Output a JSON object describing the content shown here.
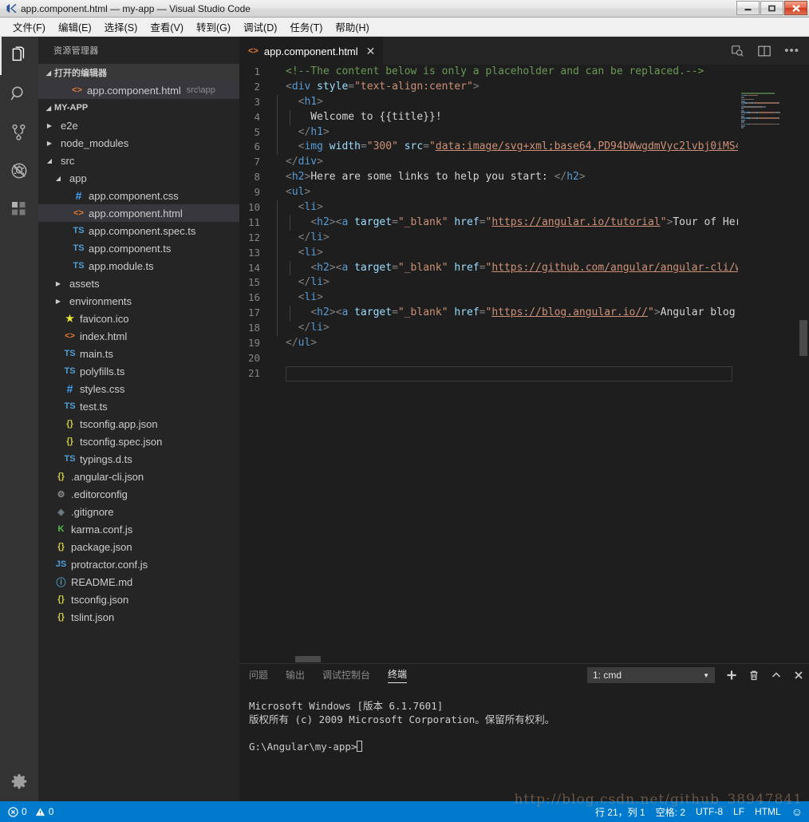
{
  "window": {
    "title": "app.component.html — my-app — Visual Studio Code",
    "logo_icon": "vscode-logo-icon",
    "minimize_label": "—",
    "maximize_label": "❐",
    "close_label": "✕"
  },
  "menubar": {
    "items": [
      {
        "label": "文件(F)",
        "name": "menu-file"
      },
      {
        "label": "编辑(E)",
        "name": "menu-edit"
      },
      {
        "label": "选择(S)",
        "name": "menu-selection"
      },
      {
        "label": "查看(V)",
        "name": "menu-view"
      },
      {
        "label": "转到(G)",
        "name": "menu-go"
      },
      {
        "label": "调试(D)",
        "name": "menu-debug"
      },
      {
        "label": "任务(T)",
        "name": "menu-tasks"
      },
      {
        "label": "帮助(H)",
        "name": "menu-help"
      }
    ]
  },
  "activitybar": {
    "items": [
      {
        "icon": "files-explorer-icon",
        "active": true
      },
      {
        "icon": "search-icon",
        "active": false
      },
      {
        "icon": "source-control-icon",
        "active": false
      },
      {
        "icon": "debug-icon",
        "active": false
      },
      {
        "icon": "extensions-icon",
        "active": false
      }
    ],
    "settings_icon": "gear-icon"
  },
  "sidebar": {
    "title": "资源管理器",
    "open_editors": {
      "header": "打开的编辑器",
      "items": [
        {
          "name": "app.component.html",
          "description": "src\\app",
          "icon": "html-file-icon"
        }
      ]
    },
    "root": {
      "header": "MY-APP",
      "tree": [
        {
          "label": "e2e",
          "type": "folder",
          "expanded": false,
          "indent": 1
        },
        {
          "label": "node_modules",
          "type": "folder",
          "expanded": false,
          "indent": 1
        },
        {
          "label": "src",
          "type": "folder",
          "expanded": true,
          "indent": 1
        },
        {
          "label": "app",
          "type": "folder",
          "expanded": true,
          "indent": 2
        },
        {
          "label": "app.component.css",
          "type": "css",
          "indent": 3
        },
        {
          "label": "app.component.html",
          "type": "html",
          "indent": 3,
          "selected": true
        },
        {
          "label": "app.component.spec.ts",
          "type": "ts",
          "indent": 3
        },
        {
          "label": "app.component.ts",
          "type": "ts",
          "indent": 3
        },
        {
          "label": "app.module.ts",
          "type": "ts",
          "indent": 3
        },
        {
          "label": "assets",
          "type": "folder",
          "expanded": false,
          "indent": 2
        },
        {
          "label": "environments",
          "type": "folder",
          "expanded": false,
          "indent": 2
        },
        {
          "label": "favicon.ico",
          "type": "star",
          "indent": 2
        },
        {
          "label": "index.html",
          "type": "html",
          "indent": 2
        },
        {
          "label": "main.ts",
          "type": "ts",
          "indent": 2
        },
        {
          "label": "polyfills.ts",
          "type": "ts",
          "indent": 2
        },
        {
          "label": "styles.css",
          "type": "css",
          "indent": 2
        },
        {
          "label": "test.ts",
          "type": "ts",
          "indent": 2
        },
        {
          "label": "tsconfig.app.json",
          "type": "json",
          "indent": 2
        },
        {
          "label": "tsconfig.spec.json",
          "type": "json",
          "indent": 2
        },
        {
          "label": "typings.d.ts",
          "type": "ts",
          "indent": 2
        },
        {
          "label": ".angular-cli.json",
          "type": "json",
          "indent": 1
        },
        {
          "label": ".editorconfig",
          "type": "gear",
          "indent": 1
        },
        {
          "label": ".gitignore",
          "type": "git",
          "indent": 1
        },
        {
          "label": "karma.conf.js",
          "type": "karma",
          "indent": 1
        },
        {
          "label": "package.json",
          "type": "json",
          "indent": 1
        },
        {
          "label": "protractor.conf.js",
          "type": "js",
          "indent": 1
        },
        {
          "label": "README.md",
          "type": "md",
          "indent": 1
        },
        {
          "label": "tsconfig.json",
          "type": "json",
          "indent": 1
        },
        {
          "label": "tslint.json",
          "type": "json",
          "indent": 1
        }
      ]
    }
  },
  "editor": {
    "tab": {
      "label": "app.component.html",
      "icon": "html-file-icon",
      "close_label": "✕"
    },
    "actions": [
      {
        "name": "split-editor-search-icon"
      },
      {
        "name": "split-editor-icon"
      },
      {
        "name": "more-actions-icon",
        "label": "•••"
      }
    ],
    "lines": [
      {
        "n": 1,
        "tokens": [
          {
            "t": "comment",
            "v": "<!--The content below is only a placeholder and can be replaced.-->"
          }
        ]
      },
      {
        "n": 2,
        "tokens": [
          {
            "t": "brk",
            "v": "<"
          },
          {
            "t": "tag",
            "v": "div"
          },
          {
            "t": "txt",
            "v": " "
          },
          {
            "t": "attr",
            "v": "style"
          },
          {
            "t": "brk",
            "v": "="
          },
          {
            "t": "str",
            "v": "\"text-align:center\""
          },
          {
            "t": "brk",
            "v": ">"
          }
        ]
      },
      {
        "n": 3,
        "indent": 1,
        "tokens": [
          {
            "t": "txt",
            "v": "  "
          },
          {
            "t": "brk",
            "v": "<"
          },
          {
            "t": "tag",
            "v": "h1"
          },
          {
            "t": "brk",
            "v": ">"
          }
        ]
      },
      {
        "n": 4,
        "indent": 2,
        "tokens": [
          {
            "t": "txt",
            "v": "    Welcome to {{title}}!"
          }
        ]
      },
      {
        "n": 5,
        "indent": 1,
        "tokens": [
          {
            "t": "txt",
            "v": "  "
          },
          {
            "t": "brk",
            "v": "</"
          },
          {
            "t": "tag",
            "v": "h1"
          },
          {
            "t": "brk",
            "v": ">"
          }
        ]
      },
      {
        "n": 6,
        "indent": 1,
        "tokens": [
          {
            "t": "txt",
            "v": "  "
          },
          {
            "t": "brk",
            "v": "<"
          },
          {
            "t": "tag",
            "v": "img"
          },
          {
            "t": "txt",
            "v": " "
          },
          {
            "t": "attr",
            "v": "width"
          },
          {
            "t": "brk",
            "v": "="
          },
          {
            "t": "str",
            "v": "\"300\""
          },
          {
            "t": "txt",
            "v": " "
          },
          {
            "t": "attr",
            "v": "src"
          },
          {
            "t": "brk",
            "v": "="
          },
          {
            "t": "str",
            "v": "\""
          },
          {
            "t": "link",
            "v": "data:image/svg+xml;base64,PD94bWwgdmVyc2lvbj0iMS4"
          }
        ]
      },
      {
        "n": 7,
        "tokens": [
          {
            "t": "brk",
            "v": "</"
          },
          {
            "t": "tag",
            "v": "div"
          },
          {
            "t": "brk",
            "v": ">"
          }
        ]
      },
      {
        "n": 8,
        "tokens": [
          {
            "t": "brk",
            "v": "<"
          },
          {
            "t": "tag",
            "v": "h2"
          },
          {
            "t": "brk",
            "v": ">"
          },
          {
            "t": "txt",
            "v": "Here are some links to help you start: "
          },
          {
            "t": "brk",
            "v": "</"
          },
          {
            "t": "tag",
            "v": "h2"
          },
          {
            "t": "brk",
            "v": ">"
          }
        ]
      },
      {
        "n": 9,
        "tokens": [
          {
            "t": "brk",
            "v": "<"
          },
          {
            "t": "tag",
            "v": "ul"
          },
          {
            "t": "brk",
            "v": ">"
          }
        ]
      },
      {
        "n": 10,
        "indent": 1,
        "tokens": [
          {
            "t": "txt",
            "v": "  "
          },
          {
            "t": "brk",
            "v": "<"
          },
          {
            "t": "tag",
            "v": "li"
          },
          {
            "t": "brk",
            "v": ">"
          }
        ]
      },
      {
        "n": 11,
        "indent": 2,
        "tokens": [
          {
            "t": "txt",
            "v": "    "
          },
          {
            "t": "brk",
            "v": "<"
          },
          {
            "t": "tag",
            "v": "h2"
          },
          {
            "t": "brk",
            "v": "><"
          },
          {
            "t": "tag",
            "v": "a"
          },
          {
            "t": "txt",
            "v": " "
          },
          {
            "t": "attr",
            "v": "target"
          },
          {
            "t": "brk",
            "v": "="
          },
          {
            "t": "str",
            "v": "\"_blank\""
          },
          {
            "t": "txt",
            "v": " "
          },
          {
            "t": "attr",
            "v": "href"
          },
          {
            "t": "brk",
            "v": "="
          },
          {
            "t": "str",
            "v": "\""
          },
          {
            "t": "link",
            "v": "https://angular.io/tutorial"
          },
          {
            "t": "str",
            "v": "\""
          },
          {
            "t": "brk",
            "v": ">"
          },
          {
            "t": "txt",
            "v": "Tour of Her"
          }
        ]
      },
      {
        "n": 12,
        "indent": 1,
        "tokens": [
          {
            "t": "txt",
            "v": "  "
          },
          {
            "t": "brk",
            "v": "</"
          },
          {
            "t": "tag",
            "v": "li"
          },
          {
            "t": "brk",
            "v": ">"
          }
        ]
      },
      {
        "n": 13,
        "indent": 1,
        "tokens": [
          {
            "t": "txt",
            "v": "  "
          },
          {
            "t": "brk",
            "v": "<"
          },
          {
            "t": "tag",
            "v": "li"
          },
          {
            "t": "brk",
            "v": ">"
          }
        ]
      },
      {
        "n": 14,
        "indent": 2,
        "tokens": [
          {
            "t": "txt",
            "v": "    "
          },
          {
            "t": "brk",
            "v": "<"
          },
          {
            "t": "tag",
            "v": "h2"
          },
          {
            "t": "brk",
            "v": "><"
          },
          {
            "t": "tag",
            "v": "a"
          },
          {
            "t": "txt",
            "v": " "
          },
          {
            "t": "attr",
            "v": "target"
          },
          {
            "t": "brk",
            "v": "="
          },
          {
            "t": "str",
            "v": "\"_blank\""
          },
          {
            "t": "txt",
            "v": " "
          },
          {
            "t": "attr",
            "v": "href"
          },
          {
            "t": "brk",
            "v": "="
          },
          {
            "t": "str",
            "v": "\""
          },
          {
            "t": "link",
            "v": "https://github.com/angular/angular-cli/w"
          }
        ]
      },
      {
        "n": 15,
        "indent": 1,
        "tokens": [
          {
            "t": "txt",
            "v": "  "
          },
          {
            "t": "brk",
            "v": "</"
          },
          {
            "t": "tag",
            "v": "li"
          },
          {
            "t": "brk",
            "v": ">"
          }
        ]
      },
      {
        "n": 16,
        "indent": 1,
        "tokens": [
          {
            "t": "txt",
            "v": "  "
          },
          {
            "t": "brk",
            "v": "<"
          },
          {
            "t": "tag",
            "v": "li"
          },
          {
            "t": "brk",
            "v": ">"
          }
        ]
      },
      {
        "n": 17,
        "indent": 2,
        "tokens": [
          {
            "t": "txt",
            "v": "    "
          },
          {
            "t": "brk",
            "v": "<"
          },
          {
            "t": "tag",
            "v": "h2"
          },
          {
            "t": "brk",
            "v": "><"
          },
          {
            "t": "tag",
            "v": "a"
          },
          {
            "t": "txt",
            "v": " "
          },
          {
            "t": "attr",
            "v": "target"
          },
          {
            "t": "brk",
            "v": "="
          },
          {
            "t": "str",
            "v": "\"_blank\""
          },
          {
            "t": "txt",
            "v": " "
          },
          {
            "t": "attr",
            "v": "href"
          },
          {
            "t": "brk",
            "v": "="
          },
          {
            "t": "str",
            "v": "\""
          },
          {
            "t": "link",
            "v": "https://blog.angular.io//"
          },
          {
            "t": "str",
            "v": "\""
          },
          {
            "t": "brk",
            "v": ">"
          },
          {
            "t": "txt",
            "v": "Angular blog"
          }
        ]
      },
      {
        "n": 18,
        "indent": 1,
        "tokens": [
          {
            "t": "txt",
            "v": "  "
          },
          {
            "t": "brk",
            "v": "</"
          },
          {
            "t": "tag",
            "v": "li"
          },
          {
            "t": "brk",
            "v": ">"
          }
        ]
      },
      {
        "n": 19,
        "tokens": [
          {
            "t": "brk",
            "v": "</"
          },
          {
            "t": "tag",
            "v": "ul"
          },
          {
            "t": "brk",
            "v": ">"
          }
        ]
      },
      {
        "n": 20,
        "tokens": []
      },
      {
        "n": 21,
        "tokens": [],
        "current": true
      }
    ]
  },
  "panel": {
    "tabs": [
      {
        "label": "问题",
        "active": false,
        "name": "panel-tab-problems"
      },
      {
        "label": "输出",
        "active": false,
        "name": "panel-tab-output"
      },
      {
        "label": "调试控制台",
        "active": false,
        "name": "panel-tab-debug-console"
      },
      {
        "label": "终端",
        "active": true,
        "name": "panel-tab-terminal"
      }
    ],
    "terminal_select": {
      "value": "1: cmd",
      "caret": "▼"
    },
    "actions": [
      {
        "name": "new-terminal-icon",
        "label": "＋"
      },
      {
        "name": "kill-terminal-icon",
        "label": "🗑"
      },
      {
        "name": "maximize-panel-icon",
        "label": "︿"
      },
      {
        "name": "close-panel-icon",
        "label": "✕"
      }
    ],
    "terminal_lines": [
      "Microsoft Windows [版本 6.1.7601]",
      "版权所有 (c) 2009 Microsoft Corporation。保留所有权利。",
      "",
      "G:\\Angular\\my-app>"
    ]
  },
  "statusbar": {
    "errors_icon": "error-circle-icon",
    "errors": "0",
    "warnings_icon": "warning-triangle-icon",
    "warnings": "0",
    "right_items": [
      {
        "label": "行 21，列 1",
        "name": "status-cursor-position"
      },
      {
        "label": "空格: 2",
        "name": "status-indentation"
      },
      {
        "label": "UTF-8",
        "name": "status-encoding"
      },
      {
        "label": "LF",
        "name": "status-eol"
      },
      {
        "label": "HTML",
        "name": "status-language-mode"
      },
      {
        "label": "☺",
        "name": "status-feedback-smiley-icon"
      }
    ]
  },
  "watermark": {
    "text": "http://blog.csdn.net/github_38947841"
  },
  "colors": {
    "accent": "#007acc",
    "editor_bg": "#1e1e1e",
    "sidebar_bg": "#252526",
    "activitybar_bg": "#333333"
  }
}
